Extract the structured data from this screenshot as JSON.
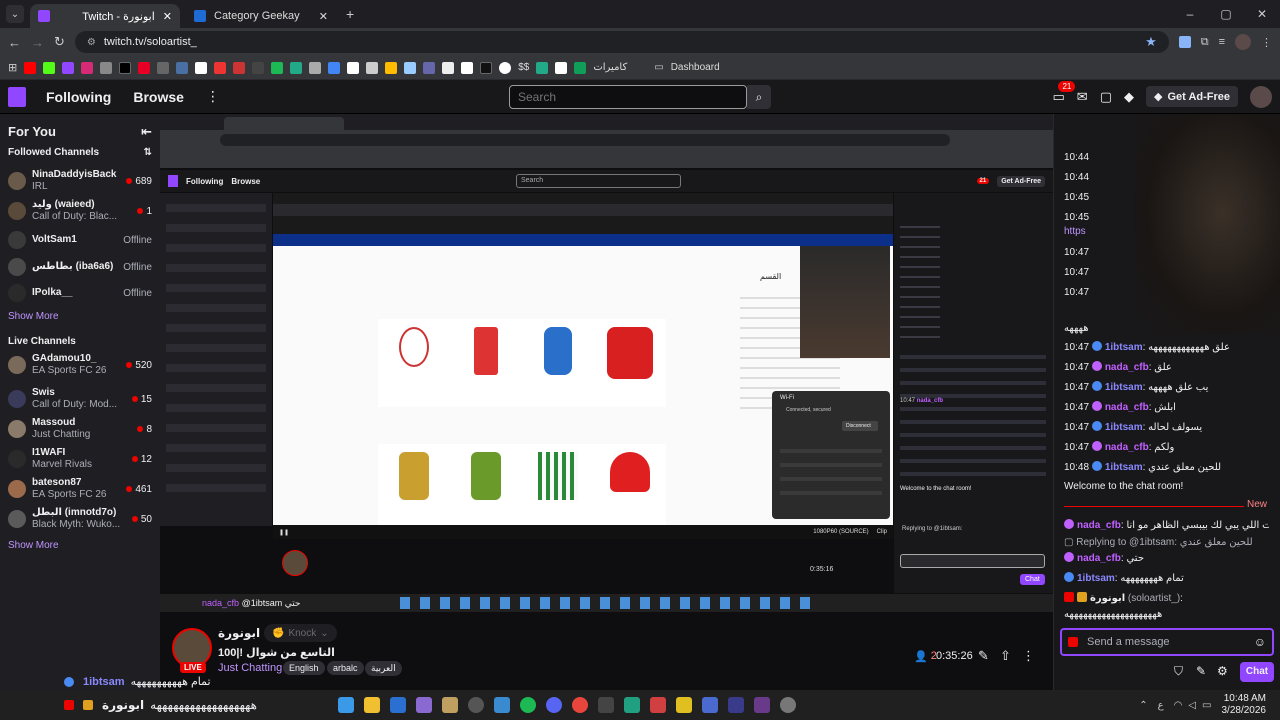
{
  "browser": {
    "tabs": [
      {
        "label": "Twitch - ابونورة"
      },
      {
        "label": "Category Geekay"
      }
    ],
    "url": "twitch.tv/soloartist_",
    "bookmarks": {
      "cameras": "كاميرات",
      "dashboard": "Dashboard",
      "currency": "$$"
    }
  },
  "twitch": {
    "nav": {
      "following": "Following",
      "browse": "Browse",
      "search_placeholder": "Search",
      "notif_count": "21",
      "ad_free": "Get Ad-Free"
    },
    "sidebar": {
      "for_you": "For You",
      "followed_heading": "Followed Channels",
      "followed": [
        {
          "name": "NinaDaddyisBack",
          "game": "IRL",
          "viewers": "689",
          "avatar": "#6a5a4a"
        },
        {
          "name": "وليد (waieed)",
          "game": "Call of Duty: Blac...",
          "viewers": "1",
          "avatar": "#5a4a3a"
        },
        {
          "name": "VoltSam1",
          "status": "Offline",
          "avatar": "#3a3a3a"
        },
        {
          "name": "بطاطس (iba6a6)",
          "status": "Offline",
          "avatar": "#4a4a4a"
        },
        {
          "name": "IPolka__",
          "status": "Offline",
          "avatar": "#2a2a2a"
        }
      ],
      "show_more_1": "Show More",
      "live_heading": "Live Channels",
      "live": [
        {
          "name": "GAdamou10_",
          "game": "EA Sports FC 26",
          "viewers": "520",
          "avatar": "#7a6a5a"
        },
        {
          "name": "Swis",
          "game": "Call of Duty: Mod...",
          "viewers": "15",
          "avatar": "#3a3a5a"
        },
        {
          "name": "Massoud",
          "game": "Just Chatting",
          "viewers": "8",
          "avatar": "#8a7a6a"
        },
        {
          "name": "I1WAFI",
          "game": "Marvel Rivals",
          "viewers": "12",
          "avatar": "#2a2a2a"
        },
        {
          "name": "bateson87",
          "game": "EA Sports FC 26",
          "viewers": "461",
          "avatar": "#9a6a4a"
        },
        {
          "name": "البطل (imnotd7o)",
          "game": "Black Myth: Wuko...",
          "viewers": "50",
          "avatar": "#5a5a5a"
        }
      ],
      "show_more_2": "Show More"
    },
    "stream": {
      "streamer": "ابونورة",
      "knock": "Knock",
      "title": "100|! التاسع من شوال",
      "category": "Just Chatting",
      "tags": [
        "English",
        "arbalc",
        "العربية"
      ],
      "live": "LIVE",
      "viewers": "2",
      "uptime": "0:35:26",
      "overlay_line1_user": "1ibtsam",
      "overlay_line1_msg": "تمام ههههههههههه",
      "overlay_line2_user": "ابونورة",
      "overlay_line2_msg": "ههههههههههههههههههه"
    },
    "chat": {
      "early": [
        {
          "time": "10:44"
        },
        {
          "time": "10:44"
        },
        {
          "time": "10:45"
        },
        {
          "time": "10:45"
        },
        {
          "time": "https"
        },
        {
          "time": "10:47"
        },
        {
          "time": "10:47"
        },
        {
          "time": "10:47"
        },
        {
          "time": "ههههه"
        }
      ],
      "messages": [
        {
          "time": "10:47",
          "user": "1ibtsam",
          "msg": "علق ههههههههههههه",
          "color": "#8a88ff"
        },
        {
          "time": "10:47",
          "user": "nada_cfb",
          "msg": "علق",
          "color": "#c060ff"
        },
        {
          "time": "10:47",
          "user": "1ibtsam",
          "msg": "يب علق ههههه",
          "color": "#8a88ff"
        },
        {
          "time": "10:47",
          "user": "nada_cfb",
          "msg": "ابلش",
          "color": "#c060ff"
        },
        {
          "time": "10:47",
          "user": "1ibtsam",
          "msg": "يسولف لحاله",
          "color": "#8a88ff"
        },
        {
          "time": "10:47",
          "user": "nada_cfb",
          "msg": "ولكم",
          "color": "#c060ff"
        },
        {
          "time": "10:48",
          "user": "1ibtsam",
          "msg": "للحين معلق عندي",
          "color": "#8a88ff"
        }
      ],
      "welcome": "Welcome to the chat room!",
      "new_label": "New",
      "recent": {
        "line1_user": "nada_cfb",
        "line1_msg": "انت اللي يبي لك بيبسي الظاهر مو انا",
        "reply_prefix": "Replying to @1ibtsam:",
        "reply_msg": "للحين معلق عندي",
        "line2_user": "nada_cfb",
        "line2_msg": "حتي",
        "line3_user": "1ibtsam",
        "line3_msg": "تمام ههههههههه",
        "line4_user": "ابونورة",
        "line4_handle": "(soloartist_)",
        "line4_msg": "ههههههههههههههههههههه"
      },
      "input_placeholder": "Send a message",
      "chat_button": "Chat"
    }
  },
  "taskbar": {
    "time": "10:48 AM",
    "date": "3/28/2026",
    "lang": "ع"
  },
  "inner": {
    "following": "Following",
    "browse": "Browse",
    "search": "Search",
    "ad_free": "Get Ad-Free",
    "uptime": "0:35:16",
    "shop_title": "القسم",
    "wifi_title": "Wi-Fi",
    "wifi_status": "Connected, secured",
    "disconnect": "Disconnect",
    "hotkey": "1080P60 (SOURCE)",
    "clip": "Clip",
    "welcome": "Welcome to the chat room!",
    "reply_prefix": "Replying to @1ibtsam:",
    "chat_btn": "Chat",
    "notif_count": "21",
    "inner_chat_time": "10:47",
    "inner_chat_user": "nada_cfb",
    "bottom_user": "nada_cfb",
    "bottom_msg": "@1ibtsam حتي"
  }
}
